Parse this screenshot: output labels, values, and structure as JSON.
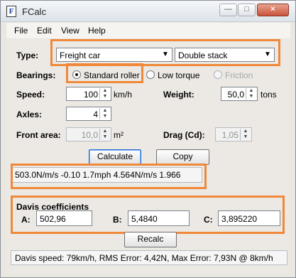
{
  "window": {
    "title": "FCalc",
    "controls": [
      "minimize",
      "maximize",
      "close"
    ]
  },
  "menu": [
    "File",
    "Edit",
    "View",
    "Help"
  ],
  "type": {
    "label": "Type:",
    "vehicle": "Freight car",
    "subtype": "Double stack"
  },
  "bearings": {
    "label": "Bearings:",
    "options": [
      "Standard roller",
      "Low torque",
      "Friction"
    ],
    "selected": "Standard roller"
  },
  "speed": {
    "label": "Speed:",
    "value": "100",
    "unit": "km/h"
  },
  "weight": {
    "label": "Weight:",
    "value": "50,0",
    "unit": "tons"
  },
  "axles": {
    "label": "Axles:",
    "value": "4"
  },
  "front_area": {
    "label": "Front area:",
    "value": "10,0",
    "unit": "m²"
  },
  "drag": {
    "label": "Drag (Cd):",
    "value": "1,05"
  },
  "buttons": {
    "calculate": "Calculate",
    "copy": "Copy",
    "recalc": "Recalc"
  },
  "result": "503.0N/m/s  -0.10  1.7mph  4.564N/m/s  1.966",
  "davis": {
    "title": "Davis coefficients",
    "a_label": "A:",
    "a_value": "502,96",
    "b_label": "B:",
    "b_value": "5,4840",
    "c_label": "C:",
    "c_value": "3,895220"
  },
  "status": "Davis speed: 79km/h,  RMS Error: 4,42N,  Max Error: 7,93N @ 8km/h",
  "colors": {
    "highlight": "#f0883a",
    "title_icon": "#1b3d9a",
    "window_bg": "#eae7e1"
  }
}
